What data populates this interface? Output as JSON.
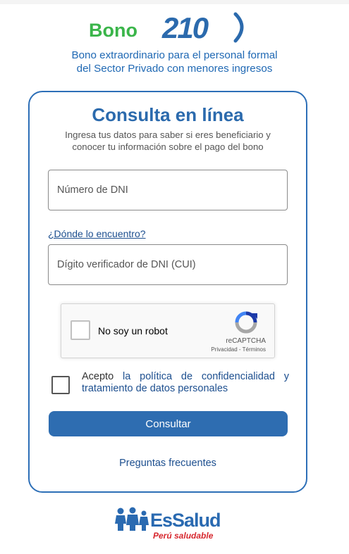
{
  "brand": {
    "logo_word": "Bono",
    "logo_number": "210",
    "subtitle_line1": "Bono extraordinario para el personal formal",
    "subtitle_line2": "del Sector Privado con menores ingresos",
    "green": "#3ab54a",
    "blue": "#2b6aad"
  },
  "form": {
    "title": "Consulta en línea",
    "desc_line1": "Ingresa tus datos para saber si eres beneficiario y",
    "desc_line2": "conocer tu información sobre el pago del bono",
    "dni_placeholder": "Número de DNI",
    "help_link": "¿Dónde lo encuentro?",
    "cui_placeholder": "Dígito verificador de DNI (CUI)",
    "recaptcha": {
      "label": "No soy un robot",
      "brand": "reCAPTCHA",
      "terms": "Privacidad - Términos"
    },
    "consent": {
      "prefix": "Acepto ",
      "link": "la política de confidencialidad y tratamiento de datos personales"
    },
    "submit_label": "Consultar",
    "faq_link": "Preguntas frecuentes"
  },
  "footer": {
    "logo_name": "EsSalud",
    "tagline": "Perú saludable"
  }
}
